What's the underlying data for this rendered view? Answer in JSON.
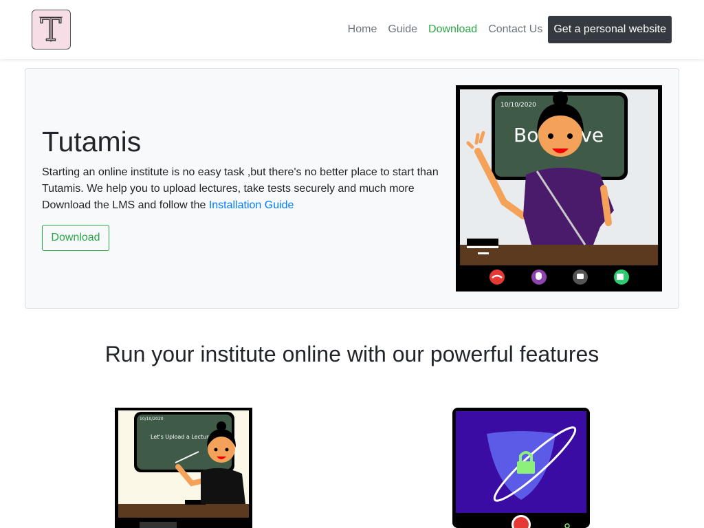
{
  "navbar": {
    "logo_letter": "T",
    "links": [
      "Home",
      "Guide",
      "Download",
      "Contact Us"
    ],
    "cta": "Get a personal website"
  },
  "hero": {
    "title": "Tutamis",
    "text_line1": "Starting an online institute is no easy task ,but there's no better place to start than Tutamis. We help you to upload lectures, take tests securely and much more",
    "text_line2_prefix": "Download the LMS and follow the ",
    "guide_link": "Installation Guide",
    "button": "Download",
    "illustration": {
      "date": "10/10/2020",
      "board_text": "Both Live"
    }
  },
  "features": {
    "title": "Run your institute online with our powerful features",
    "card1": {
      "date": "10/10/2020",
      "board_text": "Let's Upload a Lecture"
    }
  },
  "colors": {
    "accent_green": "#28a745",
    "link_blue": "#007bff",
    "dark": "#343a40",
    "board_green": "#3d5a45",
    "saree_purple": "#4a1a6b",
    "security_purple": "#3a0ca3"
  }
}
